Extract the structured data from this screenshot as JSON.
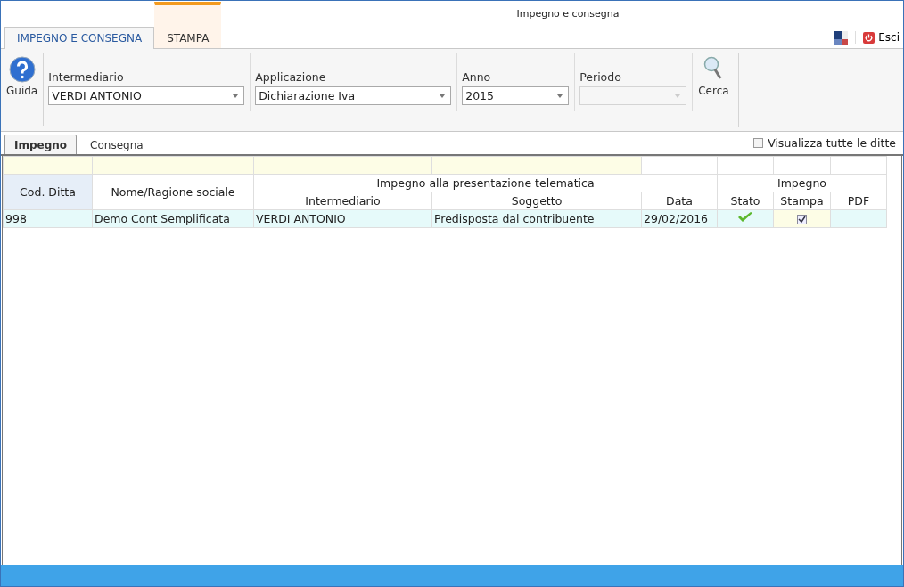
{
  "window": {
    "title": "Impegno e consegna"
  },
  "ribbon_tabs": [
    {
      "label": "IMPEGNO E CONSEGNA",
      "selected": true
    },
    {
      "label": "STAMPA",
      "selected": false
    }
  ],
  "exit_button": {
    "label": "Esci"
  },
  "toolbar": {
    "help_button": {
      "label": "Guida"
    },
    "fields": [
      {
        "label": "Intermediario",
        "value": "VERDI ANTONIO",
        "disabled": false
      },
      {
        "label": "Applicazione",
        "value": "Dichiarazione Iva",
        "disabled": false
      },
      {
        "label": "Anno",
        "value": "2015",
        "disabled": false
      },
      {
        "label": "Periodo",
        "disabled": true
      }
    ],
    "search_button": {
      "label": "Cerca"
    }
  },
  "sub_tabs": [
    {
      "label": "Impegno",
      "selected": true
    },
    {
      "label": "Consegna",
      "selected": false
    }
  ],
  "show_all": {
    "label": "Visualizza tutte le ditte",
    "checked": false
  },
  "table": {
    "group_headers": [
      "Impegno alla presentazione telematica",
      "Impegno"
    ],
    "columns": [
      "Cod. Ditta",
      "Nome/Ragione sociale",
      "Intermediario",
      "Soggetto",
      "Data",
      "Stato",
      "Stampa",
      "PDF"
    ],
    "rows": [
      {
        "cells": [
          "998",
          "Demo Cont Semplificata",
          "VERDI ANTONIO",
          "Predisposta dal contribuente",
          "29/02/2016"
        ],
        "stato_ok": true,
        "stampa_checked": true
      }
    ]
  }
}
